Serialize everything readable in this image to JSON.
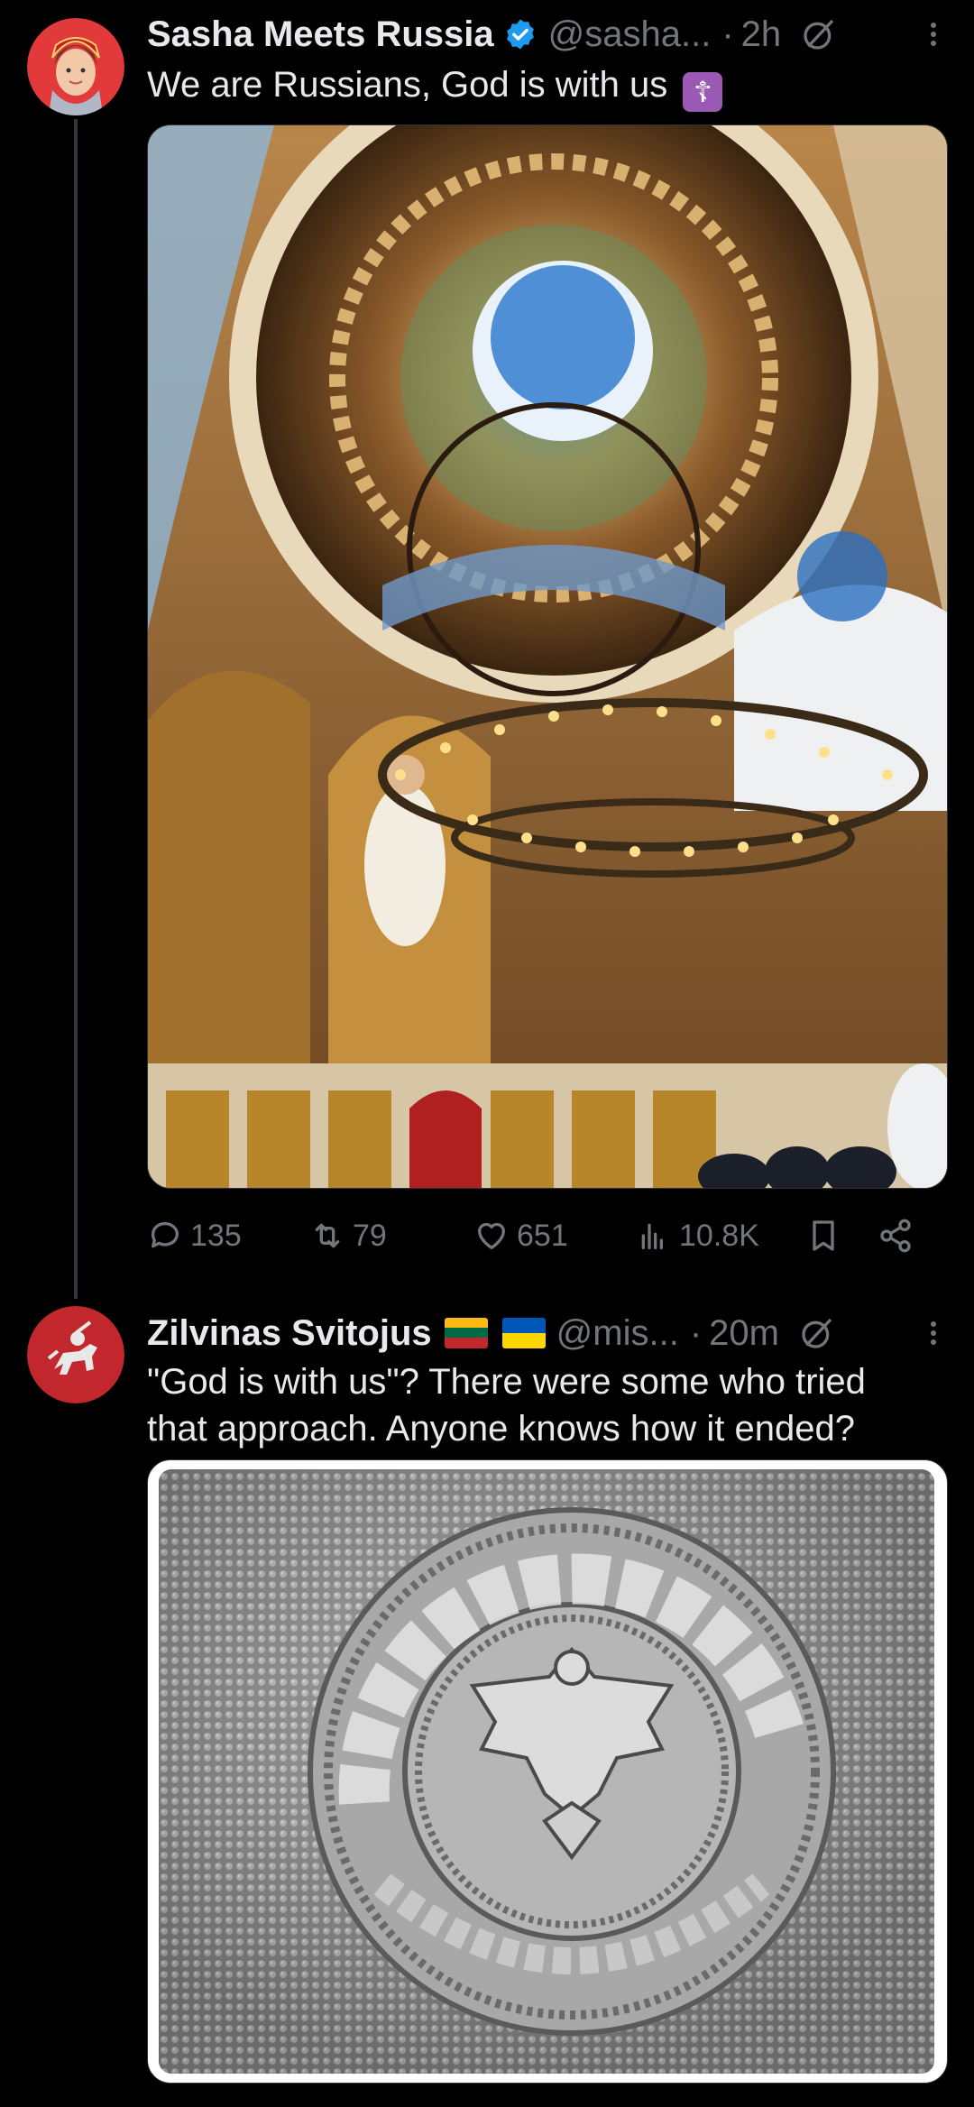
{
  "tweet1": {
    "author_name": "Sasha Meets Russia",
    "handle": "@sasha...",
    "dot": "·",
    "time": "2h",
    "text": "We are Russians, God is with us",
    "emoji": "☦",
    "actions": {
      "replies": "135",
      "reposts": "79",
      "likes": "651",
      "views": "10.8K"
    }
  },
  "tweet2": {
    "author_name": "Zilvinas Svitojus",
    "handle": "@mis...",
    "dot": "·",
    "time": "20m",
    "text_line1": "\"God is with us\"? There were some who tried",
    "text_line2": "that approach. Anyone knows how it ended?"
  },
  "colors": {
    "background": "#000000",
    "text": "#e7e9ea",
    "secondary": "#71767b",
    "verified": "#1d9bf0"
  },
  "icons": [
    "verified-badge-icon",
    "grok-icon",
    "more-icon",
    "reply-icon",
    "repost-icon",
    "like-icon",
    "views-icon",
    "bookmark-icon",
    "share-icon"
  ]
}
